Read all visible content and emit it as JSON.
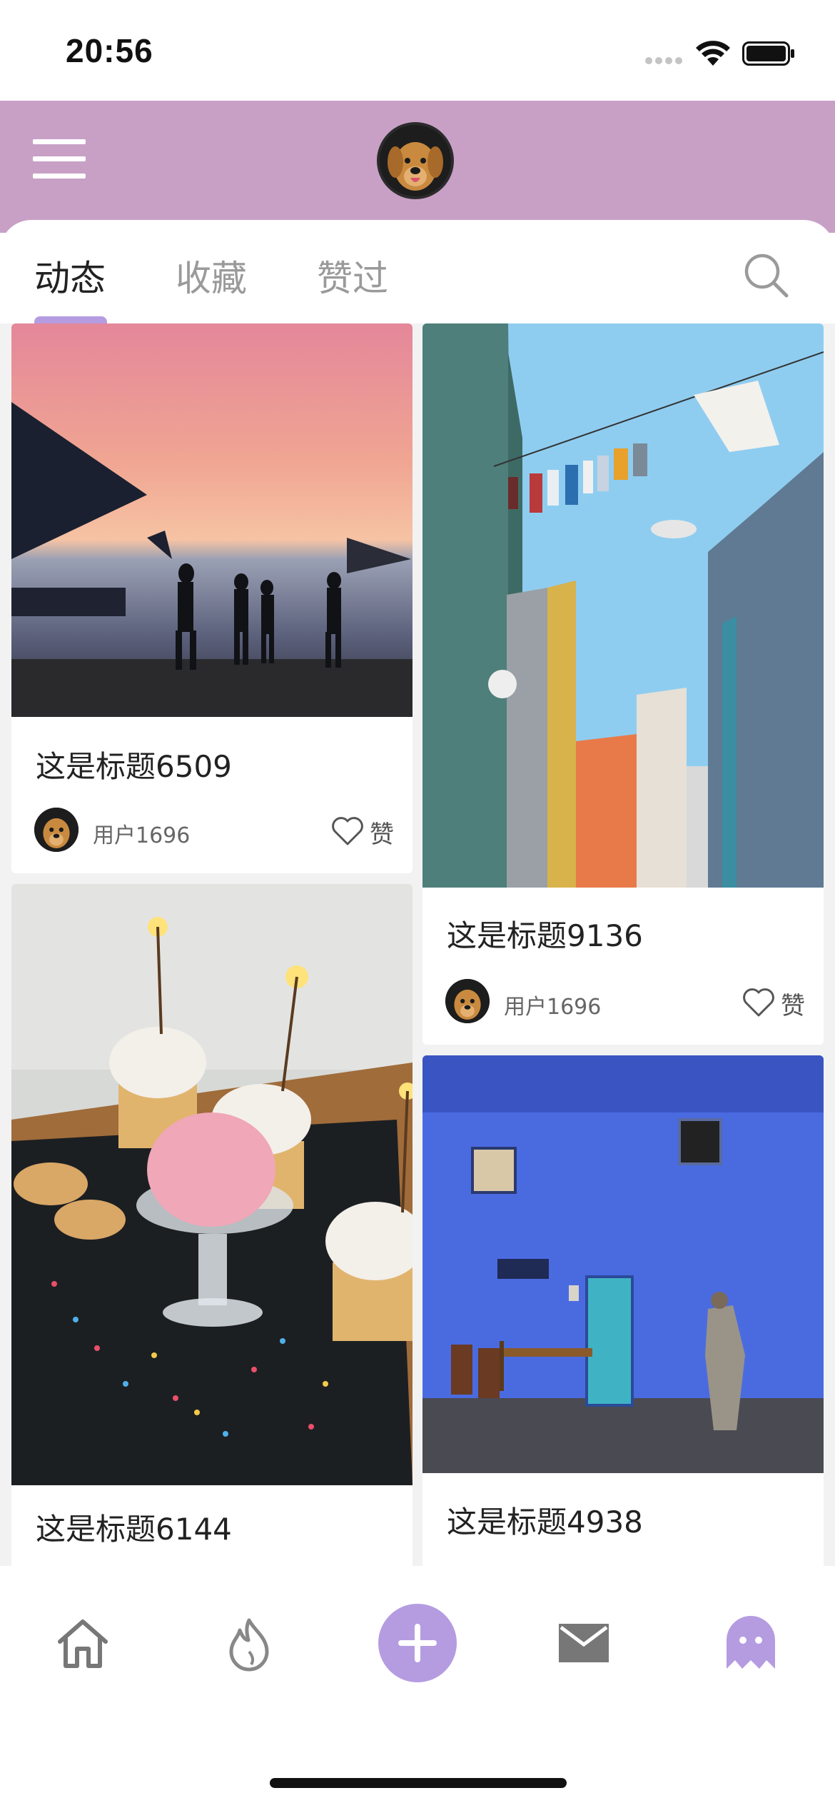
{
  "status_bar": {
    "time": "20:56"
  },
  "header": {
    "menu_icon": "hamburger-menu-icon",
    "avatar_icon": "dog-avatar"
  },
  "tabs": [
    {
      "label": "动态",
      "active": true
    },
    {
      "label": "收藏",
      "active": false
    },
    {
      "label": "赞过",
      "active": false
    }
  ],
  "accent_color": "#b59ce0",
  "header_color": "#c8a0c6",
  "posts": [
    {
      "title": "这是标题6509",
      "user": "用户1696",
      "like_label": "赞",
      "image": "sunset-beach-photo"
    },
    {
      "title": "这是标题9136",
      "user": "用户1696",
      "like_label": "赞",
      "image": "street-laundry-photo"
    },
    {
      "title": "这是标题6144",
      "image": "cupcakes-sparklers-photo"
    },
    {
      "title": "这是标题4938",
      "image": "blue-wall-street-photo"
    }
  ],
  "tab_bar": [
    {
      "icon": "home-icon"
    },
    {
      "icon": "flame-icon"
    },
    {
      "icon": "plus-icon"
    },
    {
      "icon": "mail-icon"
    },
    {
      "icon": "ghost-icon"
    }
  ]
}
